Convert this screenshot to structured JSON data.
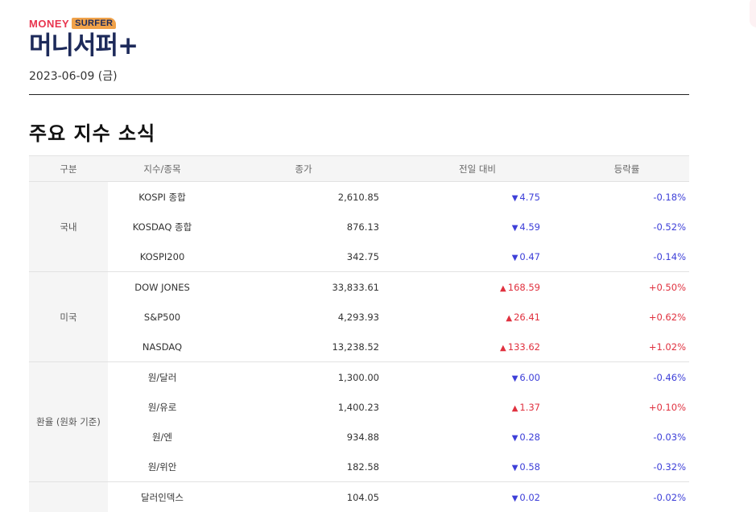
{
  "brand": {
    "logo_en_money": "MONEY",
    "logo_en_surfer": "SURFER",
    "logo_ko": "머니서퍼+",
    "date": "2023-06-09 (금)"
  },
  "section": {
    "title": "주요 지수 소식"
  },
  "colors": {
    "up": "#e0313f",
    "down": "#3d3fd8",
    "brand_navy": "#1d2a5a",
    "brand_red": "#e8344e",
    "brand_orange": "#f0a24a"
  },
  "table": {
    "headers": [
      "구분",
      "지수/종목",
      "종가",
      "전일 대비",
      "등락률"
    ],
    "groups": [
      {
        "category": "국내",
        "rows": [
          {
            "name": "KOSPI 종합",
            "close": "2,610.85",
            "change": "4.75",
            "direction": "down",
            "rate": "-0.18%"
          },
          {
            "name": "KOSDAQ 종합",
            "close": "876.13",
            "change": "4.59",
            "direction": "down",
            "rate": "-0.52%"
          },
          {
            "name": "KOSPI200",
            "close": "342.75",
            "change": "0.47",
            "direction": "down",
            "rate": "-0.14%"
          }
        ]
      },
      {
        "category": "미국",
        "rows": [
          {
            "name": "DOW JONES",
            "close": "33,833.61",
            "change": "168.59",
            "direction": "up",
            "rate": "+0.50%"
          },
          {
            "name": "S&P500",
            "close": "4,293.93",
            "change": "26.41",
            "direction": "up",
            "rate": "+0.62%"
          },
          {
            "name": "NASDAQ",
            "close": "13,238.52",
            "change": "133.62",
            "direction": "up",
            "rate": "+1.02%"
          }
        ]
      },
      {
        "category": "환율 (원화 기준)",
        "rows": [
          {
            "name": "원/달러",
            "close": "1,300.00",
            "change": "6.00",
            "direction": "down",
            "rate": "-0.46%"
          },
          {
            "name": "원/유로",
            "close": "1,400.23",
            "change": "1.37",
            "direction": "up",
            "rate": "+0.10%"
          },
          {
            "name": "원/엔",
            "close": "934.88",
            "change": "0.28",
            "direction": "down",
            "rate": "-0.03%"
          },
          {
            "name": "원/위안",
            "close": "182.58",
            "change": "0.58",
            "direction": "down",
            "rate": "-0.32%"
          }
        ]
      },
      {
        "category": "",
        "rows": [
          {
            "name": "달러인덱스",
            "close": "104.05",
            "change": "0.02",
            "direction": "down",
            "rate": "-0.02%"
          }
        ]
      }
    ]
  }
}
